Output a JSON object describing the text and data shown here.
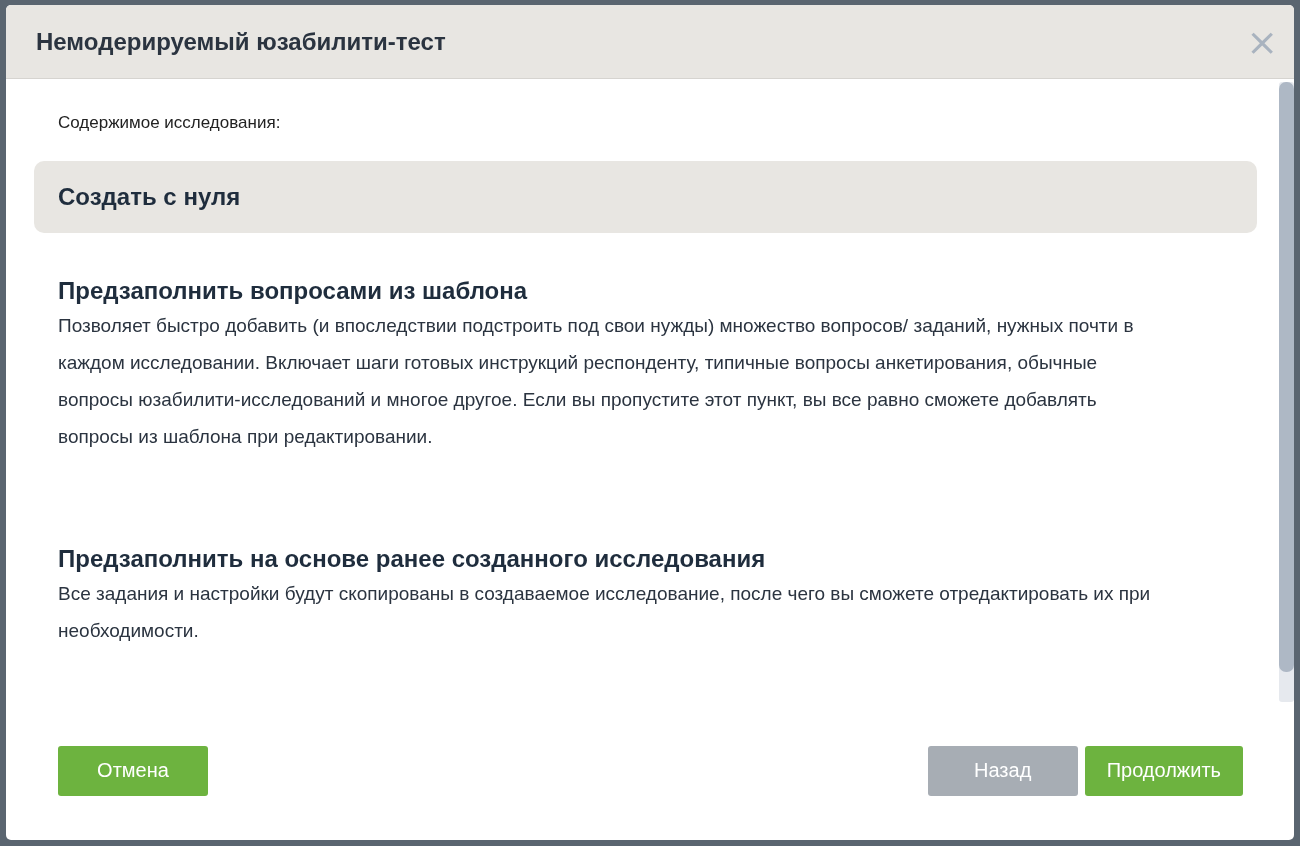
{
  "dialog": {
    "title": "Немодерируемый юзабилити-тест",
    "close": "×"
  },
  "content_label": "Содержимое исследования:",
  "options": [
    {
      "title": "Создать с нуля",
      "selected": true
    },
    {
      "title": "Предзаполнить вопросами из шаблона",
      "description": "Позволяет быстро добавить (и впоследствии подстроить под свои нужды) множество вопросов/ заданий, нужных почти в каждом исследовании. Включает шаги готовых инструкций респонденту, типичные вопросы анкетирования, обычные вопросы юзабилити-исследований и многое другое. Если вы пропустите этот пункт, вы все равно сможете добавлять вопросы из шаблона при редактировании.",
      "selected": false
    },
    {
      "title": "Предзаполнить на основе ранее созданного исследования",
      "description": "Все задания и настройки будут скопированы в создаваемое исследование, после чего вы сможете отредактировать их при необходимости.",
      "selected": false
    }
  ],
  "footer": {
    "left": [
      {
        "label": "Отмена",
        "disabled": false
      }
    ],
    "right": [
      {
        "label": "Назад",
        "disabled": true
      },
      {
        "label": "Продолжить",
        "disabled": false
      }
    ]
  }
}
